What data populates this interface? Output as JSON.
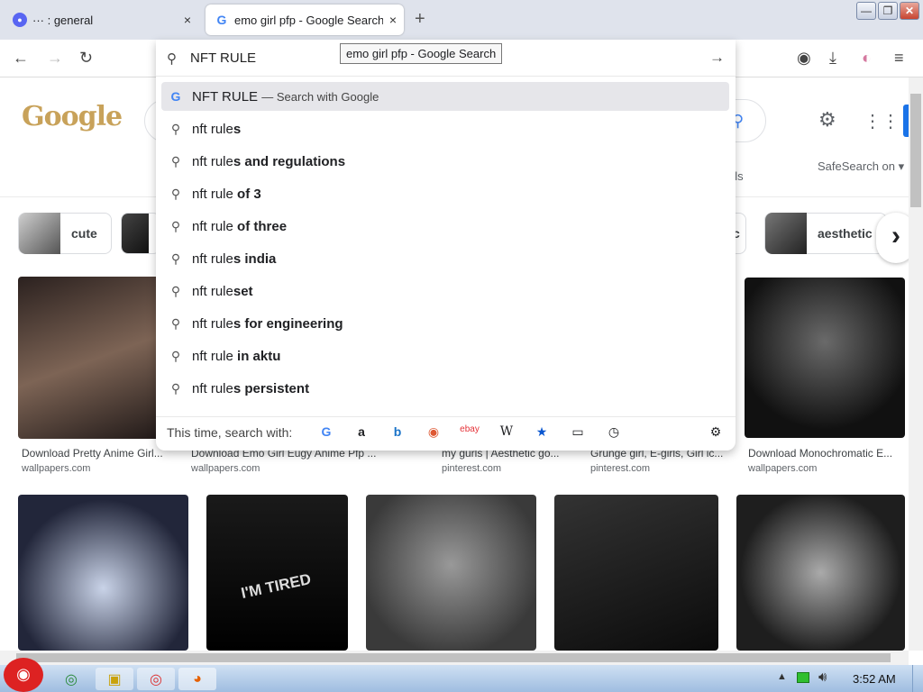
{
  "tabs": [
    {
      "label": "··· : general",
      "close": "×"
    },
    {
      "label": "emo girl pfp - Google Search",
      "close": "×"
    }
  ],
  "new_tab": "+",
  "window_buttons": {
    "minimize": "—",
    "restore": "❐",
    "close": "✕"
  },
  "nav": {
    "back": "←",
    "forward": "→",
    "reload": "↻",
    "pocket": "◉",
    "download": "⤓",
    "account": "◐",
    "menu": "≡"
  },
  "tooltip": "emo girl pfp - Google Search",
  "urlbar": {
    "value": "NFT RULE",
    "go": "→"
  },
  "suggestions": [
    {
      "prefix": "NFT RULE",
      "bold": "",
      "suffix": "— Search with Google"
    },
    {
      "prefix": "nft rule",
      "bold": "s",
      "suffix": ""
    },
    {
      "prefix": "nft rule",
      "bold": "s and regulations",
      "suffix": ""
    },
    {
      "prefix": "nft rule",
      "bold": " of 3",
      "suffix": ""
    },
    {
      "prefix": "nft rule",
      "bold": " of three",
      "suffix": ""
    },
    {
      "prefix": "nft rule",
      "bold": "s india",
      "suffix": ""
    },
    {
      "prefix": "nft rule",
      "bold": "set",
      "suffix": ""
    },
    {
      "prefix": "nft rule",
      "bold": "s for engineering",
      "suffix": ""
    },
    {
      "prefix": "nft rule",
      "bold": " in aktu",
      "suffix": ""
    },
    {
      "prefix": "nft rule",
      "bold": "s persistent",
      "suffix": ""
    }
  ],
  "engines_label": "This time, search with:",
  "engines": [
    "G",
    "a",
    "b",
    "◉",
    "ebay",
    "W",
    "★",
    "▭",
    "◷"
  ],
  "engines_settings": "⚙",
  "google": {
    "logo": "Google",
    "safesearch": "SafeSearch on ▾",
    "tools": "ols",
    "chips": [
      {
        "label": "cute"
      },
      {
        "label": "c"
      },
      {
        "label": "aesthetic"
      }
    ],
    "chip_next": "›",
    "results": [
      {
        "caption": "Download Pretty Anime Girl...",
        "source": "wallpapers.com"
      },
      {
        "caption": "Download Emo Girl Eugy Anime Pfp ...",
        "source": "wallpapers.com"
      },
      {
        "caption": "my gurls | Aesthetic go...",
        "source": "pinterest.com"
      },
      {
        "caption": "Grunge girl, E-girls, Girl ic...",
        "source": "pinterest.com"
      },
      {
        "caption": "Download Monochromatic E...",
        "source": "wallpapers.com"
      }
    ],
    "tired_text": "I'M TIRED"
  },
  "taskbar": {
    "clock": "3:52 AM"
  },
  "colors": {
    "accent": "#4285f4",
    "discord": "#5865f2",
    "taskbar": "#b7cfea"
  }
}
